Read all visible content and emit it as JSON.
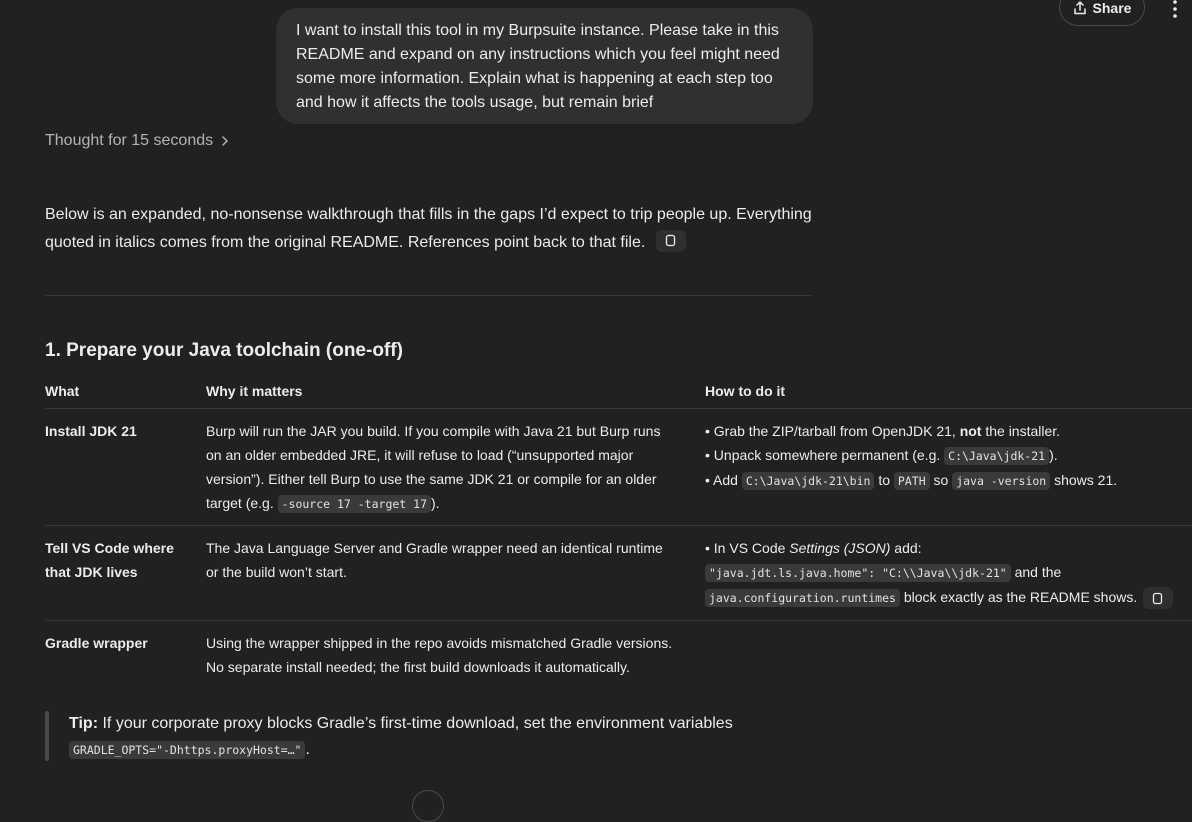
{
  "header": {
    "share_label": "Share"
  },
  "user_message": "I want to install this tool in my Burpsuite instance. Please take in this README and expand on any instructions which you feel might need some more information. Explain what is happening at each step too and how it affects the tools usage, but remain brief",
  "thought": {
    "label": "Thought for 15 seconds"
  },
  "intro": "Below is an expanded, no-nonsense walkthrough that fills in the gaps I’d expect to trip people up. Everything quoted in italics comes from the original README. References point back to that file.",
  "section": {
    "title": "1. Prepare your Java toolchain (one-off)",
    "columns": [
      "What",
      "Why it matters",
      "How to do it"
    ],
    "rows": [
      {
        "what": "Install JDK 21",
        "why_1": "Burp will run the JAR you build. If you compile with Java 21 but Burp runs on an older embedded JRE, it will refuse to load (“unsupported major version”). Either tell Burp to use the same JDK 21 or compile for an older target (e.g. ",
        "why_code": "-source 17 -target 17",
        "why_2": ").",
        "how_1a": "• Grab the ZIP/tarball from OpenJDK 21, ",
        "how_1b": "not",
        "how_1c": " the installer.",
        "how_2a": "• Unpack somewhere permanent (e.g. ",
        "how_2_code": "C:\\Java\\jdk-21",
        "how_2b": ").",
        "how_3a": "• Add ",
        "how_3_code1": "C:\\Java\\jdk-21\\bin",
        "how_3b": " to ",
        "how_3_code2": "PATH",
        "how_3c": " so ",
        "how_3_code3": "java -version",
        "how_3d": " shows 21."
      },
      {
        "what": "Tell VS Code where that JDK lives",
        "why": "The Java Language Server and Gradle wrapper need an identical runtime or the build won’t start.",
        "how_1a": "• In VS Code ",
        "how_1_em": "Settings (JSON)",
        "how_1b": " add:",
        "how_code1": "\"java.jdt.ls.java.home\": \"C:\\\\Java\\\\jdk-21\"",
        "how_2": " and the",
        "how_code2": "java.configuration.runtimes",
        "how_3": " block exactly as the README shows."
      },
      {
        "what": "Gradle wrapper",
        "why": "Using the wrapper shipped in the repo avoids mismatched Gradle versions. No separate install needed; the first build downloads it automatically."
      }
    ]
  },
  "tip": {
    "label": "Tip:",
    "text": " If your corporate proxy blocks Gradle’s first-time download, set the environment variables",
    "code": "GRADLE_OPTS=\"-Dhttps.proxyHost=…\"",
    "end": "."
  }
}
